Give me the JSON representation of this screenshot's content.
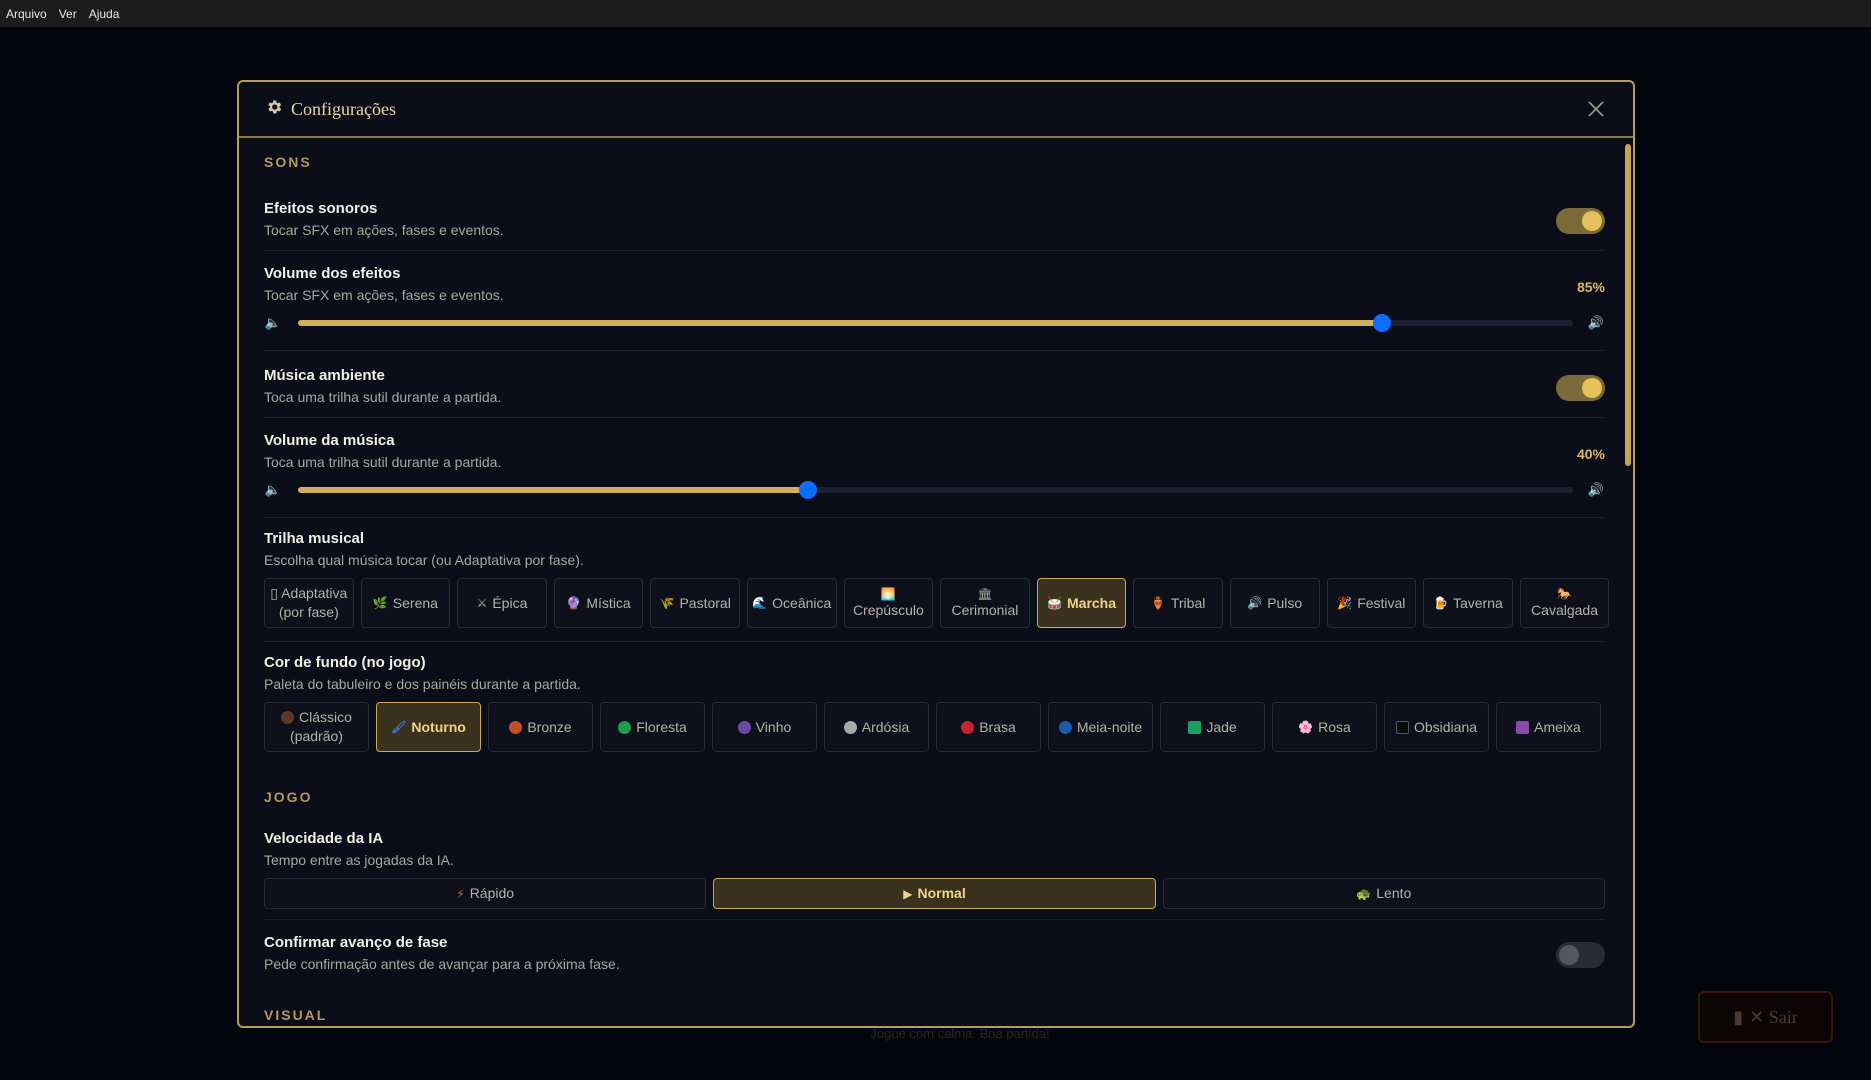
{
  "menubar": {
    "items": [
      "Arquivo",
      "Ver",
      "Ajuda"
    ]
  },
  "background": {
    "footer_text": "Jogue com calma. Boa partida!",
    "exit_label": "✕ Sair"
  },
  "modal": {
    "title": "Configurações",
    "sections": {
      "sons": "SONS",
      "jogo": "JOGO",
      "visual": "VISUAL"
    },
    "sfx": {
      "title": "Efeitos sonoros",
      "desc": "Tocar SFX em ações, fases e eventos.",
      "enabled": true
    },
    "sfx_volume": {
      "title": "Volume dos efeitos",
      "desc": "Tocar SFX em ações, fases e eventos.",
      "value": 85,
      "label": "85%"
    },
    "music": {
      "title": "Música ambiente",
      "desc": "Toca uma trilha sutil durante a partida.",
      "enabled": true
    },
    "music_volume": {
      "title": "Volume da música",
      "desc": "Toca uma trilha sutil durante a partida.",
      "value": 40,
      "label": "40%"
    },
    "track": {
      "title": "Trilha musical",
      "desc": "Escolha qual música tocar (ou Adaptativa por fase).",
      "selected": "Marcha",
      "options": [
        {
          "label": "Adaptativa",
          "label2": "(por fase)",
          "icon": "▯"
        },
        {
          "label": "Serena",
          "icon": "🌿"
        },
        {
          "label": "Épica",
          "icon": "⚔"
        },
        {
          "label": "Mística",
          "icon": "🔮"
        },
        {
          "label": "Pastoral",
          "icon": "🌾"
        },
        {
          "label": "Oceânica",
          "icon": "🌊"
        },
        {
          "label": "Crepúsculo",
          "icon": "🌅"
        },
        {
          "label": "Cerimonial",
          "icon": "🏛"
        },
        {
          "label": "Marcha",
          "icon": "🥁"
        },
        {
          "label": "Tribal",
          "icon": "🏺"
        },
        {
          "label": "Pulso",
          "icon": "🔊"
        },
        {
          "label": "Festival",
          "icon": "🎉"
        },
        {
          "label": "Taverna",
          "icon": "🍺"
        },
        {
          "label": "Cavalgada",
          "icon": "🐎"
        }
      ]
    },
    "bg_color": {
      "title": "Cor de fundo (no jogo)",
      "desc": "Paleta do tabuleiro e dos painéis durante a partida.",
      "selected": "Noturno",
      "options": [
        {
          "label": "Clássico",
          "label2": "(padrão)",
          "swatch": "#5a3a2a",
          "shape": "dot"
        },
        {
          "label": "Noturno",
          "swatch": "#3a78d8",
          "shape": "stroke"
        },
        {
          "label": "Bronze",
          "swatch": "#c0502a",
          "shape": "dot"
        },
        {
          "label": "Floresta",
          "swatch": "#1f9a4e",
          "shape": "dot"
        },
        {
          "label": "Vinho",
          "swatch": "#6a4aa8",
          "shape": "dot"
        },
        {
          "label": "Ardósia",
          "swatch": "#a8a8a8",
          "shape": "dot"
        },
        {
          "label": "Brasa",
          "swatch": "#c4242c",
          "shape": "dot"
        },
        {
          "label": "Meia-noite",
          "swatch": "#1a5aa6",
          "shape": "dot"
        },
        {
          "label": "Jade",
          "swatch": "#1aa060",
          "shape": "square"
        },
        {
          "label": "Rosa",
          "swatch": "#d85aa8",
          "shape": "flower"
        },
        {
          "label": "Obsidiana",
          "swatch": "#0a0a0a",
          "shape": "square-outline"
        },
        {
          "label": "Ameixa",
          "swatch": "#8a4aa8",
          "shape": "square"
        }
      ]
    },
    "ai_speed": {
      "title": "Velocidade da IA",
      "desc": "Tempo entre as jogadas da IA.",
      "selected": "Normal",
      "options": [
        {
          "label": "Rápido",
          "icon": "⚡"
        },
        {
          "label": "Normal",
          "icon": "▶"
        },
        {
          "label": "Lento",
          "icon": "🐢"
        }
      ]
    },
    "confirm_phase": {
      "title": "Confirmar avanço de fase",
      "desc": "Pede confirmação antes de avançar para a próxima fase.",
      "enabled": false
    }
  }
}
